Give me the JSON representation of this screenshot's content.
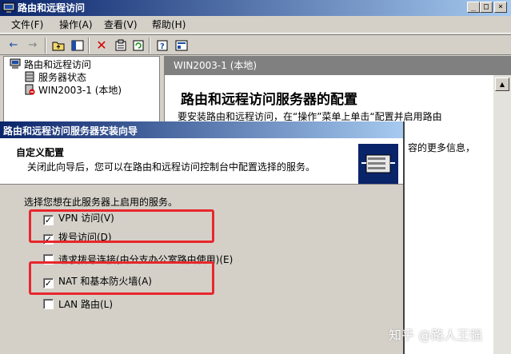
{
  "window": {
    "title": "路由和远程访问",
    "minimize": "_",
    "maximize": "□",
    "close": "×"
  },
  "menu": [
    "文件(F)",
    "操作(A)",
    "查看(V)",
    "帮助(H)"
  ],
  "toolbar_icons": [
    "back-arrow-icon",
    "forward-arrow-icon",
    "up-folder-icon",
    "show-hide-tree-icon",
    "delete-icon",
    "properties-icon",
    "refresh-icon",
    "help-icon",
    "console-icon"
  ],
  "tree": {
    "root": "路由和远程访问",
    "items": [
      "服务器状态",
      "WIN2003-1 (本地)"
    ]
  },
  "right_pane": {
    "header": "WIN2003-1 (本地)",
    "title": "路由和远程访问服务器的配置",
    "text1": "要安装路由和远程访问，在“操作”菜单上单击“配置并启用路由",
    "text2": "容的更多信息，"
  },
  "wizard": {
    "title": "路由和远程访问服务器安装向导",
    "heading": "自定义配置",
    "subtitle": "关闭此向导后，您可以在路由和远程访问控制台中配置选择的服务。",
    "prompt": "选择您想在此服务器上启用的服务。",
    "options": [
      {
        "label": "VPN 访问(V)",
        "checked": true
      },
      {
        "label": "拨号访问(D)",
        "checked": true
      },
      {
        "label": "请求拨号连接(由分支办公室路由使用)(E)",
        "checked": false
      },
      {
        "label": "NAT 和基本防火墙(A)",
        "checked": true
      },
      {
        "label": "LAN 路由(L)",
        "checked": false
      }
    ]
  },
  "watermark": "知乎 @路人王强",
  "colors": {
    "highlight_box": "#e8262c",
    "titlebar_start": "#0a246a",
    "titlebar_end": "#a6caf0",
    "face": "#d4d0c8"
  }
}
